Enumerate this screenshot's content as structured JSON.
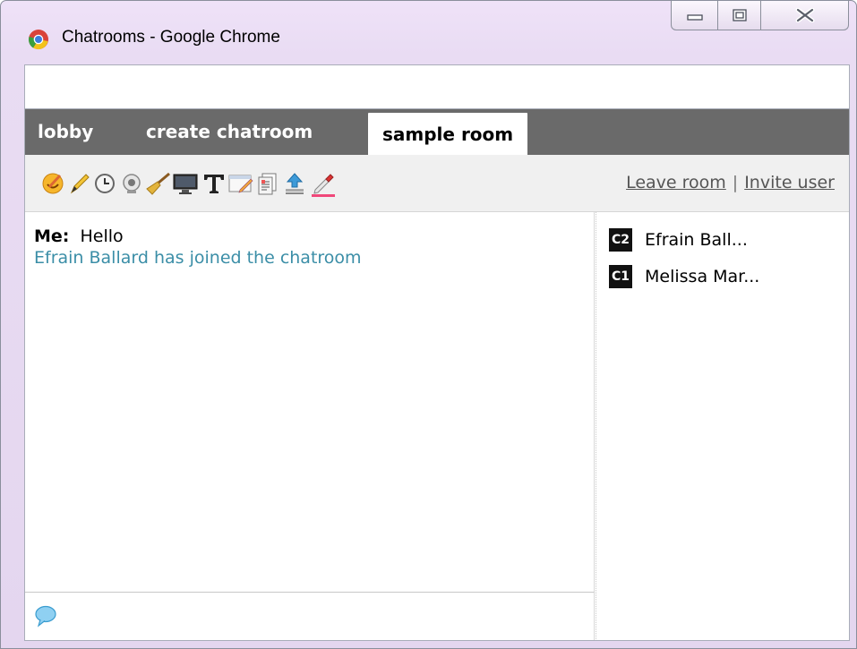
{
  "window": {
    "title": "Chatrooms - Google Chrome"
  },
  "addressbar": {
    "value": ""
  },
  "tabs": [
    {
      "label": "lobby",
      "active": false
    },
    {
      "label": "create chatroom",
      "active": false
    },
    {
      "label": "sample room",
      "active": true
    }
  ],
  "toolbar": {
    "icons": [
      "emoticon-icon",
      "pencil-icon",
      "clock-icon",
      "webcam-icon",
      "broom-icon",
      "monitor-icon",
      "text-icon",
      "edit-window-icon",
      "documents-icon",
      "upload-icon",
      "color-picker-icon"
    ],
    "leave_label": "Leave room",
    "separator": "|",
    "invite_label": "Invite user"
  },
  "chat": {
    "messages": [
      {
        "speaker": "Me:",
        "text": "Hello"
      }
    ],
    "system_message": "Efrain Ballard has joined the chatroom",
    "input_value": "",
    "input_icon": "speech-bubble-icon"
  },
  "users": [
    {
      "badge": "C2",
      "name": "Efrain Ball..."
    },
    {
      "badge": "C1",
      "name": "Melissa Mar..."
    }
  ],
  "colors": {
    "tab_bar": "#6a6a6a",
    "system_message": "#3b8ea7",
    "window_frame": "#e9dcf3"
  }
}
